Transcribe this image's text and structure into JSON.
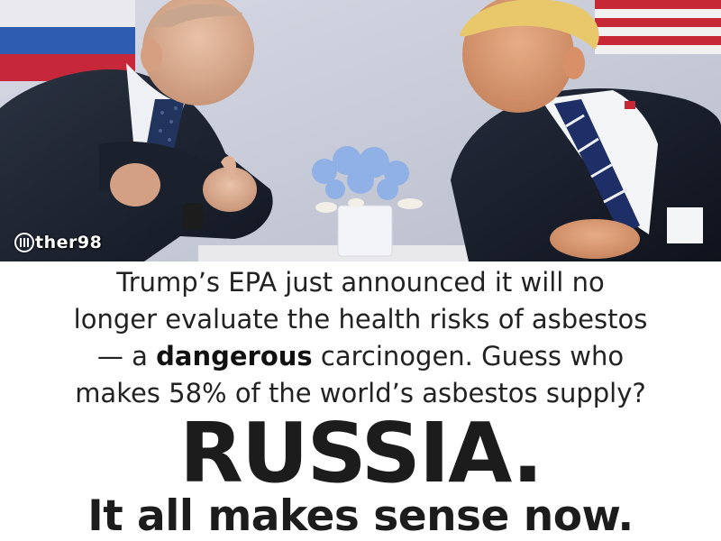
{
  "watermark": {
    "icon": "flag-circle-icon",
    "text": "ther98"
  },
  "caption": {
    "line1": "Trump’s EPA just announced it will no",
    "line2": "longer evaluate the health risks of asbestos",
    "line3_prefix": "— a ",
    "line3_bold": "dangerous",
    "line3_suffix": " carcinogen. Guess who",
    "line4": "makes 58% of the world’s asbestos supply?"
  },
  "headline": "RUSSIA.",
  "tagline": "It all makes sense now.",
  "colors": {
    "text": "#222222",
    "background": "#ffffff",
    "photo_backdrop": "#c9ccd8"
  }
}
